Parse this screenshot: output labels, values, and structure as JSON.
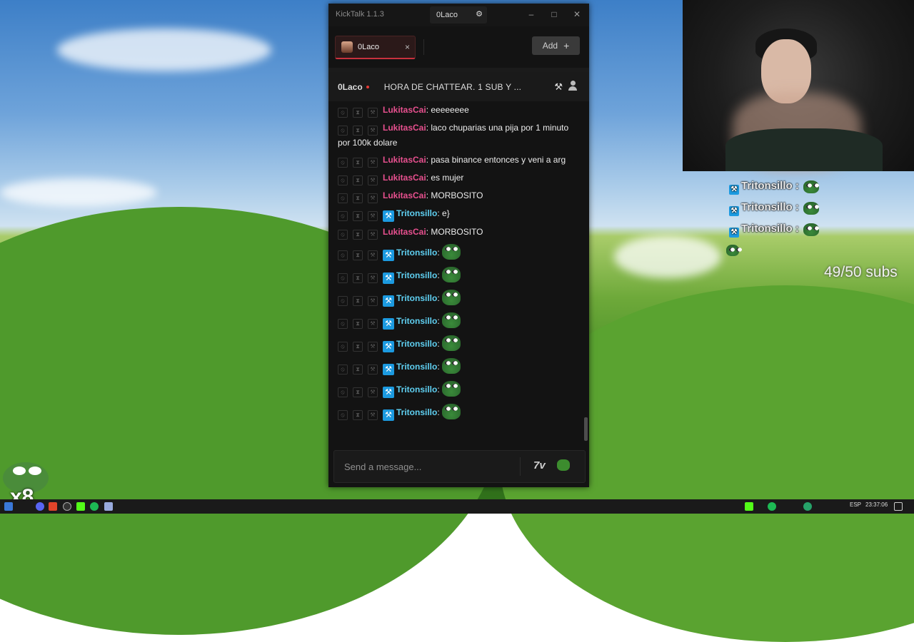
{
  "window": {
    "title": "KickTalk 1.1.3",
    "user": "0Laco",
    "minimize": "–",
    "maximize": "□",
    "close": "✕"
  },
  "tabs": [
    {
      "name": "0Laco",
      "close": "×"
    }
  ],
  "add_button": {
    "label": "Add",
    "icon": "+"
  },
  "channel": {
    "name": "0Laco",
    "title": "HORA DE CHATTEAR. 1 SUB Y ..."
  },
  "messages": [
    {
      "user": "LukitasCai",
      "color": "#e8508f",
      "badge": false,
      "text": "eeeeeeee"
    },
    {
      "user": "LukitasCai",
      "color": "#e8508f",
      "badge": false,
      "text": "laco chuparias una pija por 1 minuto por 100k dolare"
    },
    {
      "user": "LukitasCai",
      "color": "#e8508f",
      "badge": false,
      "text": "pasa binance entonces y veni a arg"
    },
    {
      "user": "LukitasCai",
      "color": "#e8508f",
      "badge": false,
      "text": "es mujer"
    },
    {
      "user": "LukitasCai",
      "color": "#e8508f",
      "badge": false,
      "text": "MORBOSITO"
    },
    {
      "user": "Tritonsillo",
      "color": "#5fd0f2",
      "badge": true,
      "text": "e}"
    },
    {
      "user": "LukitasCai",
      "color": "#e8508f",
      "badge": false,
      "text": "MORBOSITO"
    },
    {
      "user": "Tritonsillo",
      "color": "#5fd0f2",
      "badge": true,
      "emote": true
    },
    {
      "user": "Tritonsillo",
      "color": "#5fd0f2",
      "badge": true,
      "emote": true
    },
    {
      "user": "Tritonsillo",
      "color": "#5fd0f2",
      "badge": true,
      "emote": true
    },
    {
      "user": "Tritonsillo",
      "color": "#5fd0f2",
      "badge": true,
      "emote": true
    },
    {
      "user": "Tritonsillo",
      "color": "#5fd0f2",
      "badge": true,
      "emote": true
    },
    {
      "user": "Tritonsillo",
      "color": "#5fd0f2",
      "badge": true,
      "emote": true
    },
    {
      "user": "Tritonsillo",
      "color": "#5fd0f2",
      "badge": true,
      "emote": true
    },
    {
      "user": "Tritonsillo",
      "color": "#5fd0f2",
      "badge": true,
      "emote": true
    }
  ],
  "input": {
    "placeholder": "Send a message...",
    "seventv_label": "7v"
  },
  "overlay": {
    "chat": [
      {
        "user": "Tritonsillo :"
      },
      {
        "user": "Tritonsillo :"
      },
      {
        "user": "Tritonsillo :"
      }
    ],
    "subs_goal": "49/50 subs",
    "emote_combo": "x8"
  },
  "taskbar": {
    "language": "ESP",
    "time": "23:37:06"
  },
  "icons": {
    "settings": "gear-icon",
    "hammer": "hammer-icon",
    "user": "user-icon"
  }
}
